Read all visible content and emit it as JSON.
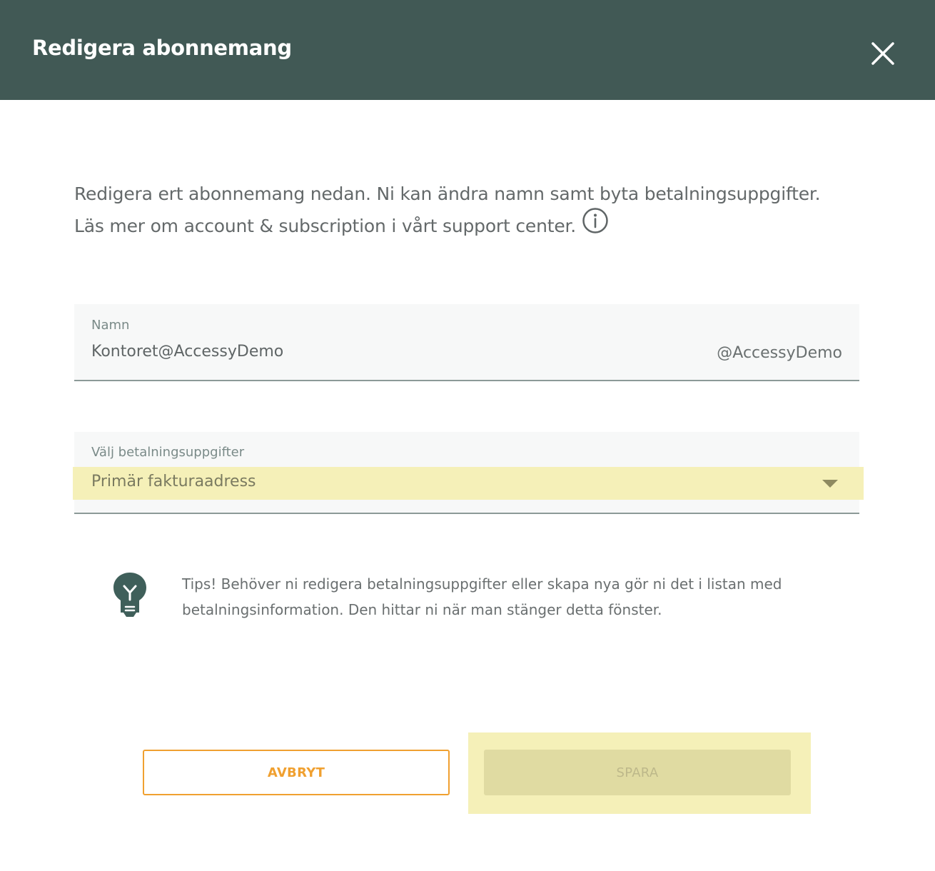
{
  "header": {
    "title": "Redigera abonnemang",
    "close_icon": "close-icon"
  },
  "intro": {
    "line1": "Redigera ert abonnemang nedan. Ni kan ändra namn samt byta betalningsuppgifter.",
    "line2": "Läs mer om account & subscription i vårt support center.",
    "info_icon": "info-icon"
  },
  "name_field": {
    "label": "Namn",
    "value": "Kontoret@AccessyDemo",
    "suffix": "@AccessyDemo"
  },
  "payment_field": {
    "label": "Välj betalningsuppgifter",
    "selected": "Primär fakturaadress",
    "arrow_icon": "dropdown-arrow-icon"
  },
  "tip": {
    "icon": "lightbulb-icon",
    "line1": "Tips! Behöver ni redigera betalningsuppgifter eller skapa nya gör ni det i listan med",
    "line2": "betalningsinformation. Den hittar ni när man stänger detta fönster."
  },
  "actions": {
    "cancel_label": "AVBRYT",
    "save_label": "SPARA"
  },
  "colors": {
    "header_bg": "#415955",
    "accent_orange": "#f0a030",
    "highlight_yellow": "#f5f0b8",
    "save_disabled_bg": "#e0dba2"
  }
}
